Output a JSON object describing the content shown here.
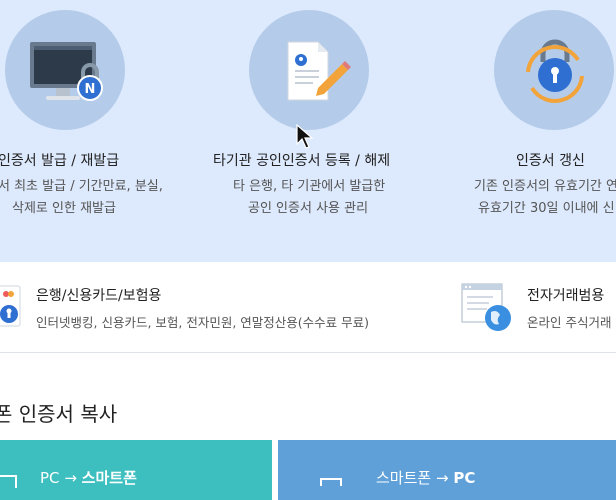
{
  "cards": [
    {
      "title": "인증서 발급 / 재발급",
      "desc1": "서 최초 발급 / 기간만료, 분실,",
      "desc2": "삭제로 인한 재발급",
      "icon": "monitor-lock-icon",
      "badge": "N"
    },
    {
      "title": "타기관 공인인증서 등록 / 해제",
      "desc1": "타 은행, 타 기관에서 발급한",
      "desc2": "공인 인증서 사용 관리",
      "icon": "document-pen-icon"
    },
    {
      "title": "인증서 갱신",
      "desc1": "기존 인증서의 유효기간 연",
      "desc2": "유효기간 30일 이내에 신",
      "icon": "lock-renew-icon"
    }
  ],
  "types": [
    {
      "title": "은행/신용카드/보험용",
      "desc": "인터넷뱅킹, 신용카드, 보험, 전자민원, 연말정산용(수수료 무료)",
      "icon": "bank-cert-icon"
    },
    {
      "title": "전자거래범용",
      "desc": "온라인 주식거래",
      "icon": "globe-window-icon"
    }
  ],
  "section": {
    "title": "폰 인증서 복사"
  },
  "copy_cards": [
    {
      "from": "PC",
      "arrow": "→",
      "to": "스마트폰",
      "color": "#3dbfbf"
    },
    {
      "from": "스마트폰",
      "arrow": "→",
      "to": "PC",
      "color": "#5fa0d8"
    }
  ],
  "colors": {
    "band": "#dde9fc",
    "circle": "#b4ccea",
    "badge": "#2e6fd1",
    "lock_ring": "#f2a33a"
  }
}
